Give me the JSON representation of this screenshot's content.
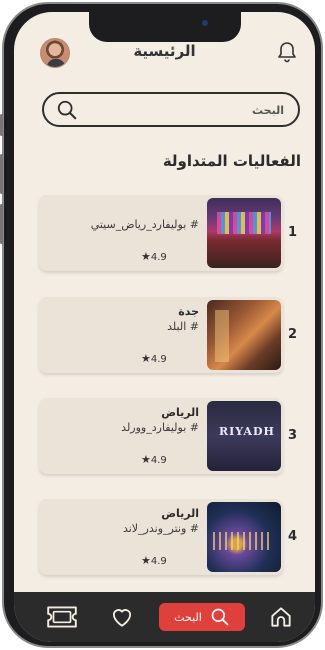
{
  "header": {
    "title": "الرئيسية"
  },
  "search": {
    "placeholder": "البحث"
  },
  "section": {
    "title": "الفعاليات المتداولة"
  },
  "events": [
    {
      "number": "1",
      "city": "",
      "tag": "# بوليفارد_رياض_سيتي",
      "rating": "4.9",
      "image": "boulevard-city-lights"
    },
    {
      "number": "2",
      "city": "جدة",
      "tag": "# البلد",
      "rating": "4.9",
      "image": "jeddah-albalad-street"
    },
    {
      "number": "3",
      "city": "الرياض",
      "tag": "# بوليفارد_وورلد",
      "rating": "4.9",
      "image": "riyadh-season-poster"
    },
    {
      "number": "4",
      "city": "الرياض",
      "tag": "# ونتر_وندر_لاند",
      "rating": "4.9",
      "image": "winter-wonderland-night"
    }
  ],
  "tabbar": {
    "search_label": "البحث"
  },
  "colors": {
    "background": "#f3ede4",
    "card": "#ece3d8",
    "accent": "#e0403c",
    "tabbar": "#2b2b2b"
  }
}
